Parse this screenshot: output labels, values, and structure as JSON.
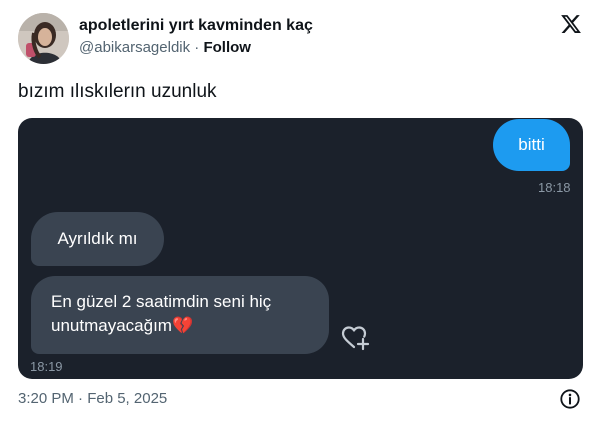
{
  "author": {
    "display_name": "apoletlerini yırt kavminden kaç",
    "handle": "@abikarsageldik",
    "separator": "·",
    "follow_label": "Follow",
    "avatar_icon": "profile-photo-avatar"
  },
  "brand": {
    "logo_icon": "x-logo-icon"
  },
  "tweet": {
    "text": "bızım ılıskılerın uzunluk"
  },
  "chat": {
    "sent_message": {
      "text": "bitti",
      "time": "18:18"
    },
    "received_messages": [
      {
        "text": "Ayrıldık mı"
      },
      {
        "text": "En güzel 2 saatimdin seni hiç unutmayacağım💔"
      }
    ],
    "received_time": "18:19",
    "react_icon": "heart-plus-icon",
    "colors": {
      "background": "#1b212b",
      "sent_bubble": "#1d9bf0",
      "received_bubble": "#3a4451"
    }
  },
  "footer": {
    "timestamp": "3:20 PM · Feb 5, 2025",
    "info_icon": "info-icon"
  }
}
